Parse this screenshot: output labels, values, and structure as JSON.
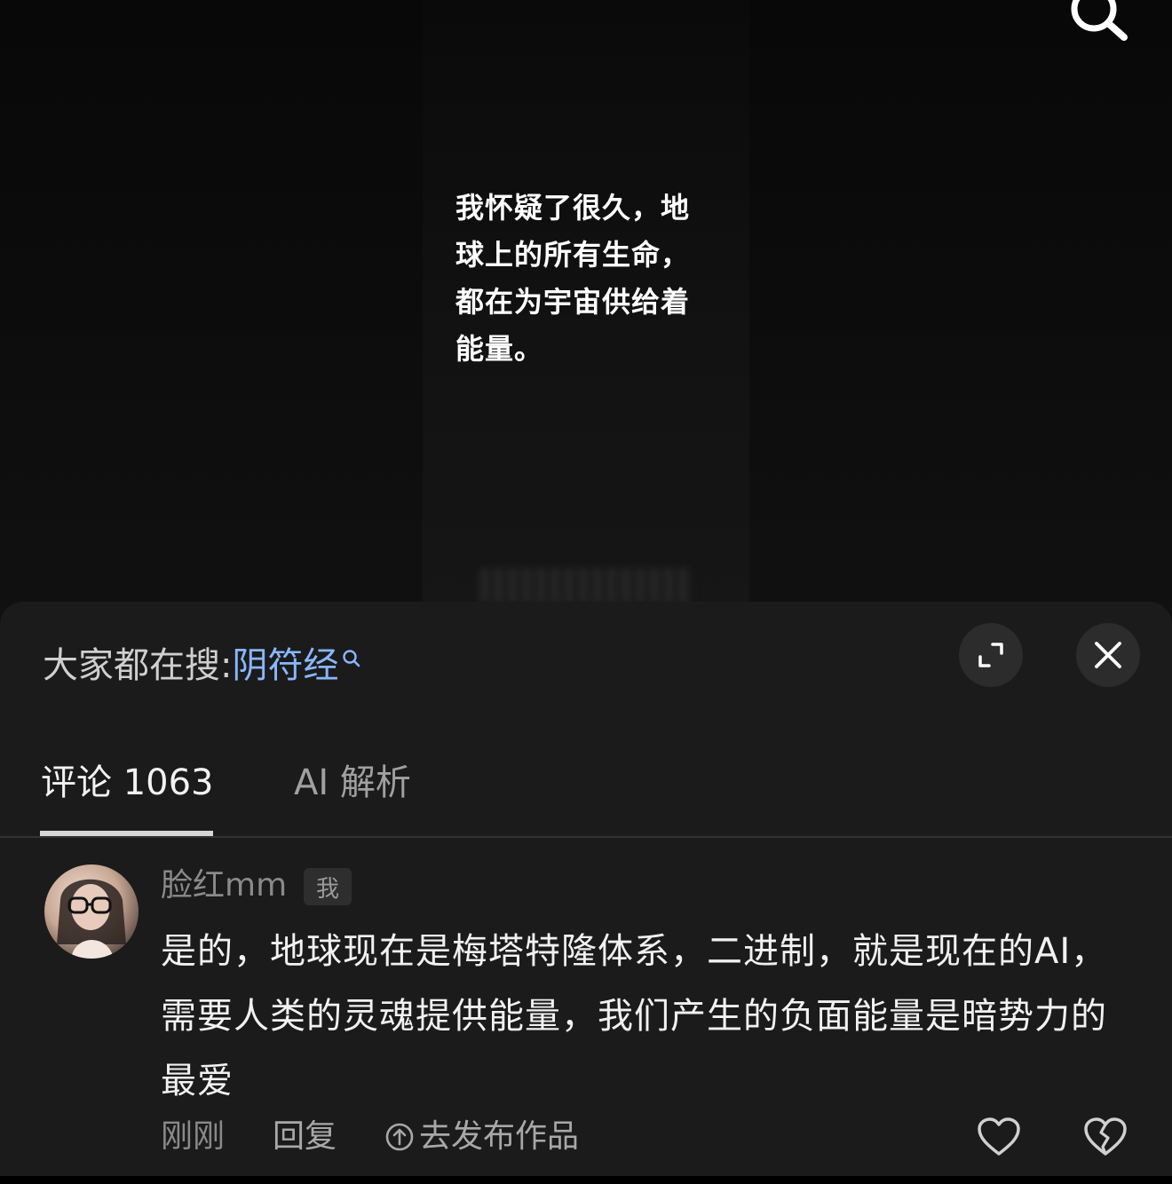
{
  "video": {
    "caption": "我怀疑了很久，地\n球上的所有生命，\n都在为宇宙供给着\n能量。"
  },
  "top_bar": {
    "search_icon": "search-icon"
  },
  "panel": {
    "trending_label": "大家都在搜:",
    "trending_keyword": "阴符经",
    "expand_icon": "expand-icon",
    "close_icon": "close-icon"
  },
  "tabs": [
    {
      "label": "评论 1063",
      "active": true
    },
    {
      "label": "AI 解析",
      "active": false
    }
  ],
  "comments": [
    {
      "username": "脸红mm",
      "badge": "我",
      "text": "是的，地球现在是梅塔特隆体系，二进制，就是现在的AI，需要人类的灵魂提供能量，我们产生的负面能量是暗势力的最爱",
      "time": "刚刚",
      "reply_label": "回复",
      "publish_label": "去发布作品",
      "icons": {
        "like": "heart-icon",
        "dislike": "broken-heart-icon",
        "publish": "upload-circle-icon"
      }
    }
  ],
  "colors": {
    "accent_link": "#8ab7ff",
    "panel_bg": "#1b1b1b",
    "text_primary": "#f1f1f1",
    "text_secondary": "#8a8a8a"
  }
}
